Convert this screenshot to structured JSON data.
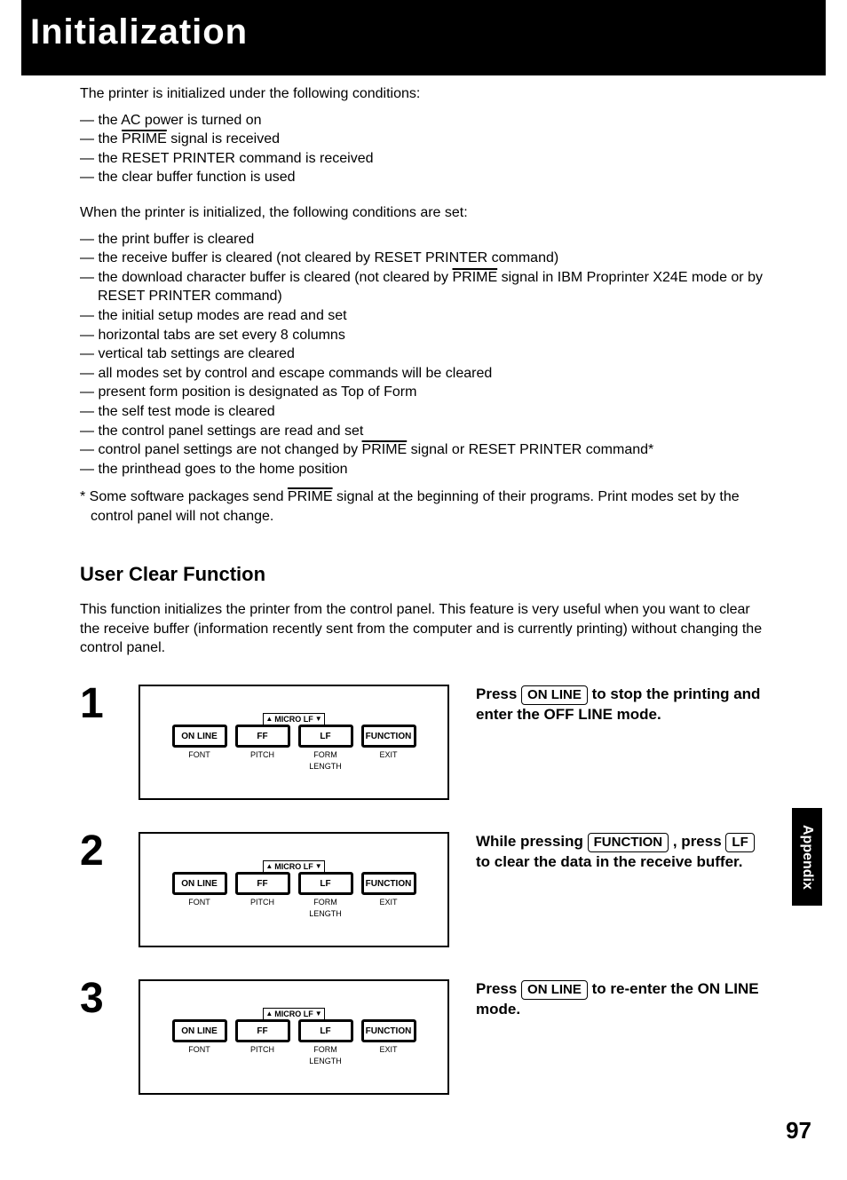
{
  "header": {
    "title": "Initialization"
  },
  "intro": "The printer is initialized under the following conditions:",
  "conditions": {
    "c1_pre": "the AC power is turned on",
    "c2_pre": "the ",
    "c2_ov": "PRIME",
    "c2_post": " signal is received",
    "c3": "the RESET PRINTER command is received",
    "c4": "the clear buffer function is used"
  },
  "set_intro": "When the printer is initialized, the following conditions are set:",
  "set": {
    "s1": "the print buffer is cleared",
    "s2": "the receive buffer is cleared (not cleared by RESET PRINTER command)",
    "s3_pre": "the download character buffer is cleared (not cleared by ",
    "s3_ov": "PRIME",
    "s3_post": " signal in IBM Proprinter X24E mode or by RESET PRINTER command)",
    "s4": "the initial setup modes are read and set",
    "s5": "horizontal tabs are set every 8 columns",
    "s6": "vertical tab settings are cleared",
    "s7": "all modes set by control and escape commands will be cleared",
    "s8": "present form position is designated as Top of Form",
    "s9": "the self test mode is cleared",
    "s10": "the control panel settings are read and set",
    "s11_pre": "control panel settings are not changed by ",
    "s11_ov": "PRIME",
    "s11_post": " signal or RESET PRINTER command*",
    "s12": "the printhead goes to the home position"
  },
  "footnote": {
    "pre": "* Some software packages send ",
    "ov": "PRIME",
    "post": " signal at the beginning of their programs. Print modes set by the control panel will not change."
  },
  "section": {
    "title": "User Clear Function",
    "desc": "This function initializes the printer from the control panel. This feature is very useful when you want to clear the receive buffer (information recently sent from the computer and is currently printing) without changing the control panel."
  },
  "panel": {
    "micro": "MICRO LF",
    "btn1": "ON LINE",
    "btn2": "FF",
    "btn3": "LF",
    "btn4": "FUNCTION",
    "sub1": "FONT",
    "sub2": "PITCH",
    "sub3": "FORM LENGTH",
    "sub4": "EXIT"
  },
  "steps": {
    "n1": "1",
    "n2": "2",
    "n3": "3",
    "i1_a": "Press ",
    "i1_key": "ON LINE",
    "i1_b": " to stop the printing and enter the OFF LINE mode.",
    "i2_a": "While pressing ",
    "i2_key1": "FUNCTION",
    "i2_b": " , press ",
    "i2_key2": "LF",
    "i2_c": " to clear the data in the receive buffer.",
    "i3_a": "Press ",
    "i3_key": "ON LINE",
    "i3_b": " to re-enter the ON LINE mode."
  },
  "tab": "Appendix",
  "page": "97"
}
